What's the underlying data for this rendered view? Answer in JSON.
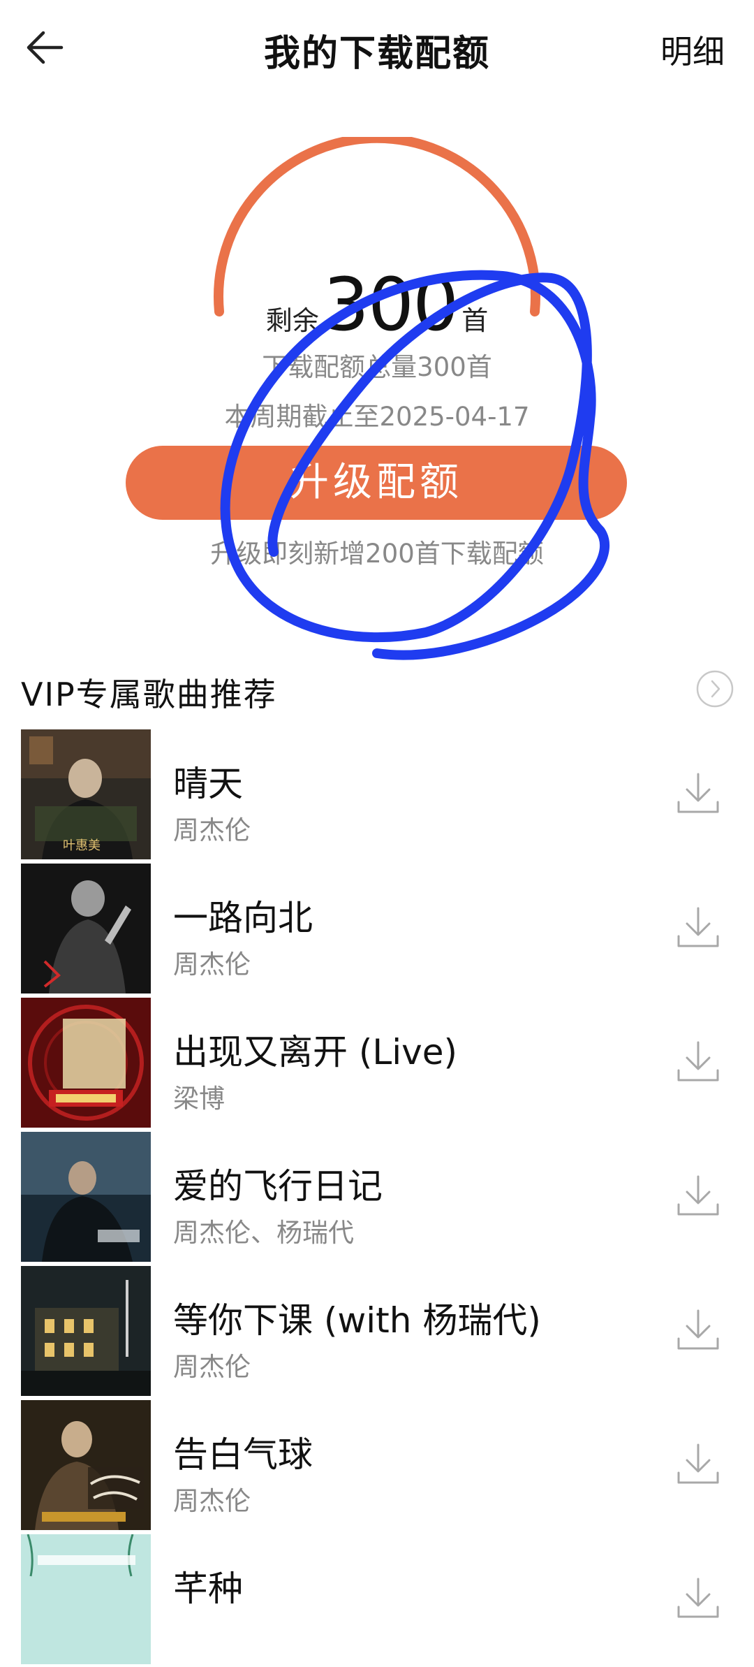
{
  "header": {
    "title": "我的下载配额",
    "detail_label": "明细",
    "back_icon": "arrow-left-icon"
  },
  "quota": {
    "remain_prefix": "剩余",
    "remain_number": "300",
    "remain_suffix": "首",
    "remaining_fraction": 1.0,
    "total_text": "下载配额总量300首",
    "deadline_text": "本周期截止至2025-04-17",
    "upgrade_label": "升级配额",
    "upgrade_hint": "升级即刻新增200首下载配额"
  },
  "vip_section": {
    "title": "VIP专属歌曲推荐",
    "more_icon": "chevron-right-circle-icon"
  },
  "songs": [
    {
      "title": "晴天",
      "artist": "周杰伦"
    },
    {
      "title": "一路向北",
      "artist": "周杰伦"
    },
    {
      "title": "出现又离开 (Live)",
      "artist": "梁博"
    },
    {
      "title": "爱的飞行日记",
      "artist": "周杰伦、杨瑞代"
    },
    {
      "title": "等你下课 (with 杨瑞代)",
      "artist": "周杰伦"
    },
    {
      "title": "告白气球",
      "artist": "周杰伦"
    },
    {
      "title": "芊种",
      "artist": ""
    }
  ],
  "colors": {
    "accent": "#ea7249",
    "annotation": "#1f3cf0",
    "secondary_text": "#888888"
  }
}
